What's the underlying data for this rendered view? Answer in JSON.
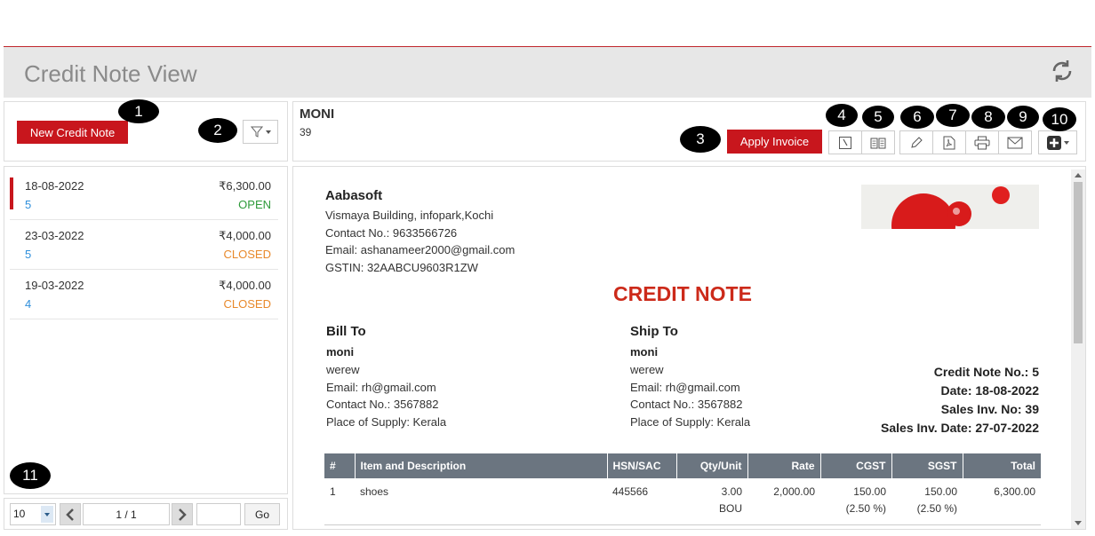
{
  "header": {
    "title": "Credit Note View"
  },
  "left": {
    "new_button": "New Credit Note",
    "items": [
      {
        "date": "18-08-2022",
        "amount": "₹6,300.00",
        "number": "5",
        "status": "OPEN"
      },
      {
        "date": "23-03-2022",
        "amount": "₹4,000.00",
        "number": "5",
        "status": "CLOSED"
      },
      {
        "date": "19-03-2022",
        "amount": "₹4,000.00",
        "number": "4",
        "status": "CLOSED"
      }
    ],
    "pager": {
      "page_size": "10",
      "page_info": "1 / 1",
      "go_label": "Go"
    }
  },
  "detail": {
    "customer_name": "MONI",
    "customer_sub": "39",
    "apply_button": "Apply Invoice"
  },
  "markers": [
    "1",
    "2",
    "3",
    "4",
    "5",
    "6",
    "7",
    "8",
    "9",
    "10",
    "11"
  ],
  "document": {
    "company": "Aabasoft",
    "address": "Vismaya Building, infopark,Kochi",
    "contact": "Contact No.: 9633566726",
    "email": "Email: ashanameer2000@gmail.com",
    "gstin": "GSTIN: 32AABCU9603R1ZW",
    "title": "CREDIT NOTE",
    "bill_to": {
      "heading": "Bill To",
      "name": "moni",
      "line": "werew",
      "email": "Email: rh@gmail.com",
      "contact": "Contact No.: 3567882",
      "supply": "Place of Supply: Kerala"
    },
    "ship_to": {
      "heading": "Ship To",
      "name": "moni",
      "line": "werew",
      "email": "Email: rh@gmail.com",
      "contact": "Contact No.: 3567882",
      "supply": "Place of Supply: Kerala"
    },
    "meta": {
      "credit_no": "Credit Note No.: 5",
      "date": "Date: 18-08-2022",
      "sales_inv": "Sales Inv. No: 39",
      "sales_inv_date": "Sales Inv. Date: 27-07-2022"
    },
    "table": {
      "headers": [
        "#",
        "Item and Description",
        "HSN/SAC",
        "Qty/Unit",
        "Rate",
        "CGST",
        "SGST",
        "Total"
      ],
      "rows": [
        {
          "num": "1",
          "item": "shoes",
          "hsn": "445566",
          "qty": "3.00",
          "unit": "BOU",
          "rate": "2,000.00",
          "cgst": "150.00",
          "cgst_pct": "(2.50 %)",
          "sgst": "150.00",
          "sgst_pct": "(2.50 %)",
          "total": "6,300.00"
        }
      ]
    }
  },
  "colors": {
    "accent": "#c8161d",
    "open": "#2e9a3a",
    "closed": "#e8892b",
    "link": "#2f8fdb",
    "table_header": "#6b7580"
  }
}
